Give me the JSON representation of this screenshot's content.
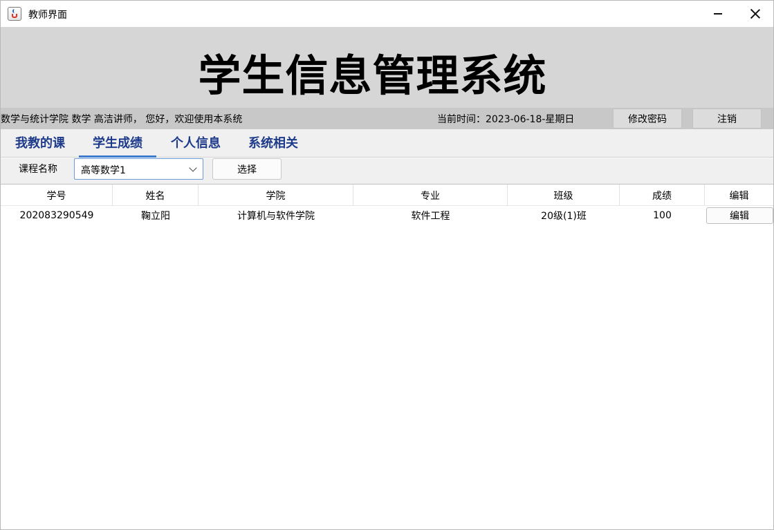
{
  "window": {
    "title": "教师界面",
    "icon": "java-cup-icon"
  },
  "banner": {
    "title": "学生信息管理系统"
  },
  "infobar": {
    "welcome": "数学与统计学院 数学 高洁讲师， 您好，欢迎使用本系统",
    "time": "当前时间：2023-06-18-星期日",
    "change_password": "修改密码",
    "logout": "注销"
  },
  "tabs": [
    {
      "label": "我教的课"
    },
    {
      "label": "学生成绩"
    },
    {
      "label": "个人信息"
    },
    {
      "label": "系统相关"
    }
  ],
  "course": {
    "label": "课程名称",
    "selected": "高等数学1",
    "choose_button": "选择"
  },
  "table": {
    "headers": [
      "学号",
      "姓名",
      "学院",
      "专业",
      "班级",
      "成绩",
      "编辑"
    ],
    "rows": [
      {
        "id": "202083290549",
        "name": "鞠立阳",
        "college": "计算机与软件学院",
        "major": "软件工程",
        "class": "20级(1)班",
        "score": "100",
        "action": "编辑"
      }
    ]
  },
  "colors": {
    "active_tab_underline": "#3d7bcf",
    "tab_text": "#1e3a8a",
    "banner_bg": "#d6d6d6"
  }
}
